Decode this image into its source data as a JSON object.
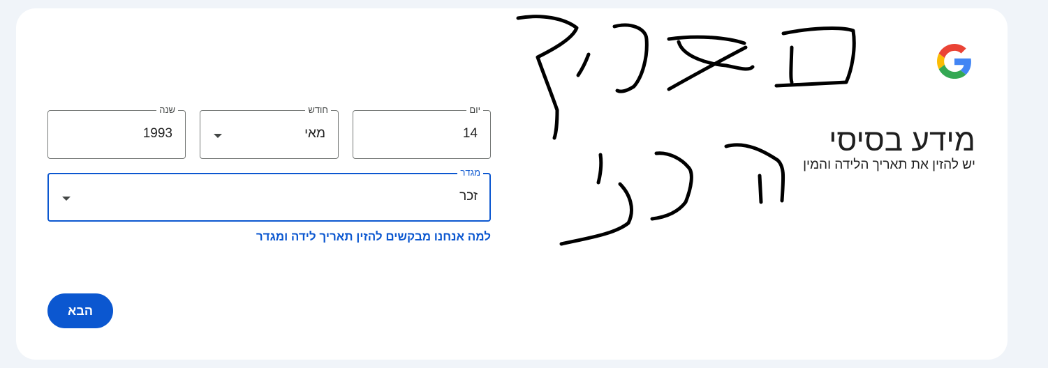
{
  "header": {
    "logo_icon": "google-g-logo",
    "title": "מידע בסיסי",
    "subtitle": "יש להזין את תאריך הלידה והמין"
  },
  "form": {
    "day": {
      "label": "יום",
      "value": "14"
    },
    "month": {
      "label": "חודש",
      "value": "מאי"
    },
    "year": {
      "label": "שנה",
      "value": "1993"
    },
    "gender": {
      "label": "מגדר",
      "value": "זכר"
    },
    "why_link": "למה אנחנו מבקשים להזין תאריך לידה ומגדר",
    "next_button": "הבא"
  },
  "annotation": {
    "handwritten_text": "תאריך הלידה"
  },
  "colors": {
    "page_background": "#f0f4f9",
    "card_background": "#ffffff",
    "accent": "#0b57d0",
    "text": "#1f1f1f",
    "border": "#747775",
    "ink": "#000000"
  }
}
